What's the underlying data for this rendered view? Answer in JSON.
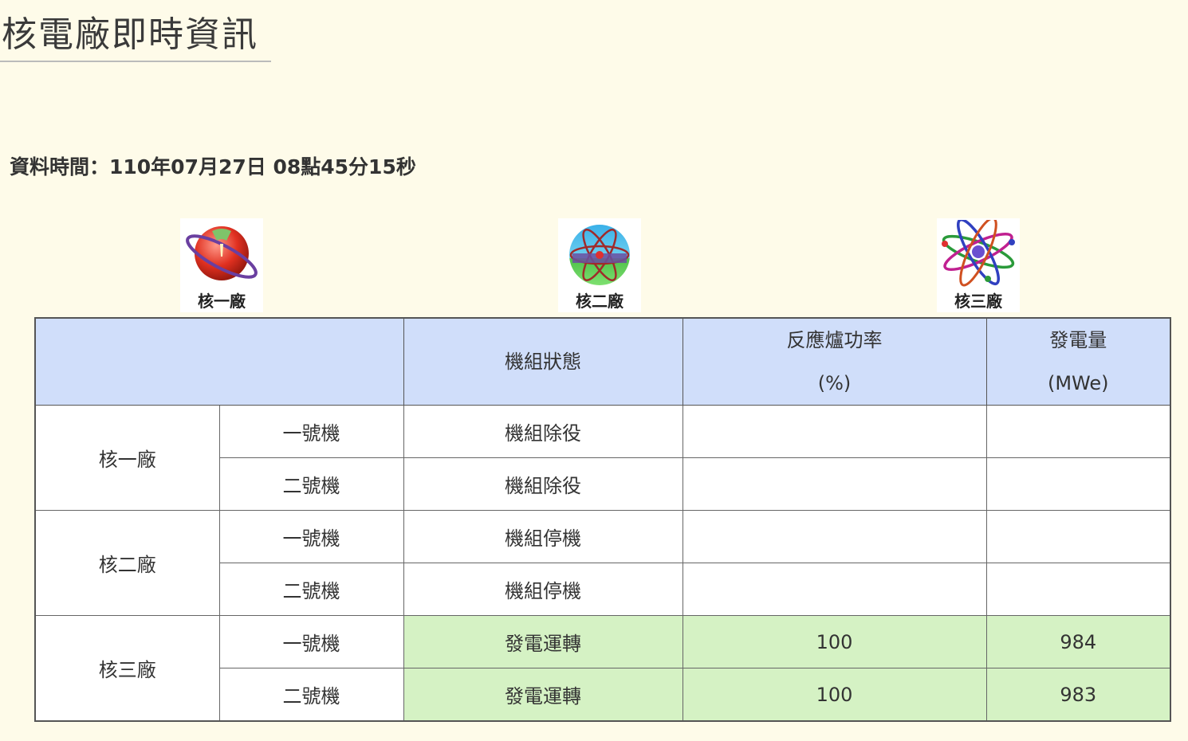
{
  "page": {
    "title": "核電廠即時資訊",
    "timestamp": "資料時間：110年07月27日 08點45分15秒"
  },
  "logos": [
    {
      "label": "核一廠",
      "icon": "globe-orbit-icon"
    },
    {
      "label": "核二廠",
      "icon": "atom-globe-icon"
    },
    {
      "label": "核三廠",
      "icon": "atom-orbits-icon"
    }
  ],
  "table": {
    "headers": {
      "plant": "",
      "status": "機組狀態",
      "power_line1": "反應爐功率",
      "power_line2": "(%)",
      "output_line1": "發電量",
      "output_line2": "(MWe)"
    },
    "plants": [
      {
        "name": "核一廠",
        "units": [
          {
            "unit": "一號機",
            "status": "機組除役",
            "power": "",
            "output": "",
            "running": false
          },
          {
            "unit": "二號機",
            "status": "機組除役",
            "power": "",
            "output": "",
            "running": false
          }
        ]
      },
      {
        "name": "核二廠",
        "units": [
          {
            "unit": "一號機",
            "status": "機組停機",
            "power": "",
            "output": "",
            "running": false
          },
          {
            "unit": "二號機",
            "status": "機組停機",
            "power": "",
            "output": "",
            "running": false
          }
        ]
      },
      {
        "name": "核三廠",
        "units": [
          {
            "unit": "一號機",
            "status": "發電運轉",
            "power": "100",
            "output": "984",
            "running": true
          },
          {
            "unit": "二號機",
            "status": "發電運轉",
            "power": "100",
            "output": "983",
            "running": true
          }
        ]
      }
    ]
  },
  "colors": {
    "background": "#fefbe9",
    "header_bg": "#d0defa",
    "running_bg": "#d5f2c4"
  }
}
